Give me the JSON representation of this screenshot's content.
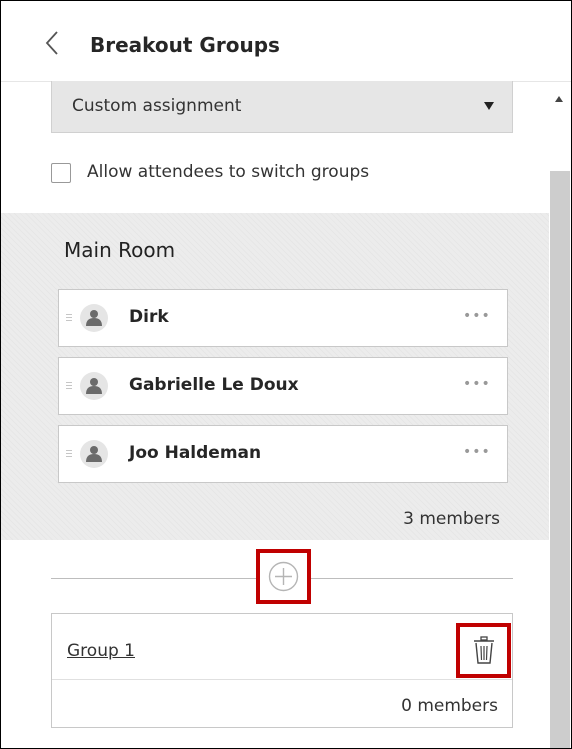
{
  "header": {
    "title": "Breakout Groups"
  },
  "assignment": {
    "selected": "Custom assignment"
  },
  "switch_option": {
    "label": "Allow attendees to switch groups",
    "checked": false
  },
  "main_room": {
    "title": "Main Room",
    "members": [
      {
        "name": "Dirk",
        "more": "•••"
      },
      {
        "name": "Gabrielle Le Doux",
        "more": "•••"
      },
      {
        "name": "Joo Haldeman",
        "more": "•••"
      }
    ],
    "count_text": "3 members"
  },
  "groups": [
    {
      "name": "Group 1",
      "count_text": "0 members"
    }
  ],
  "colors": {
    "highlight": "#c00000",
    "panel_bg": "#ececec",
    "scrollbar": "#cdcdcd"
  },
  "icons": {
    "back": "chevron-left-icon",
    "dropdown": "caret-down-icon",
    "avatar": "user-icon",
    "more": "ellipsis-icon",
    "add": "plus-circle-icon",
    "delete": "trash-icon",
    "scroll": "scroll-up-arrow-icon"
  }
}
